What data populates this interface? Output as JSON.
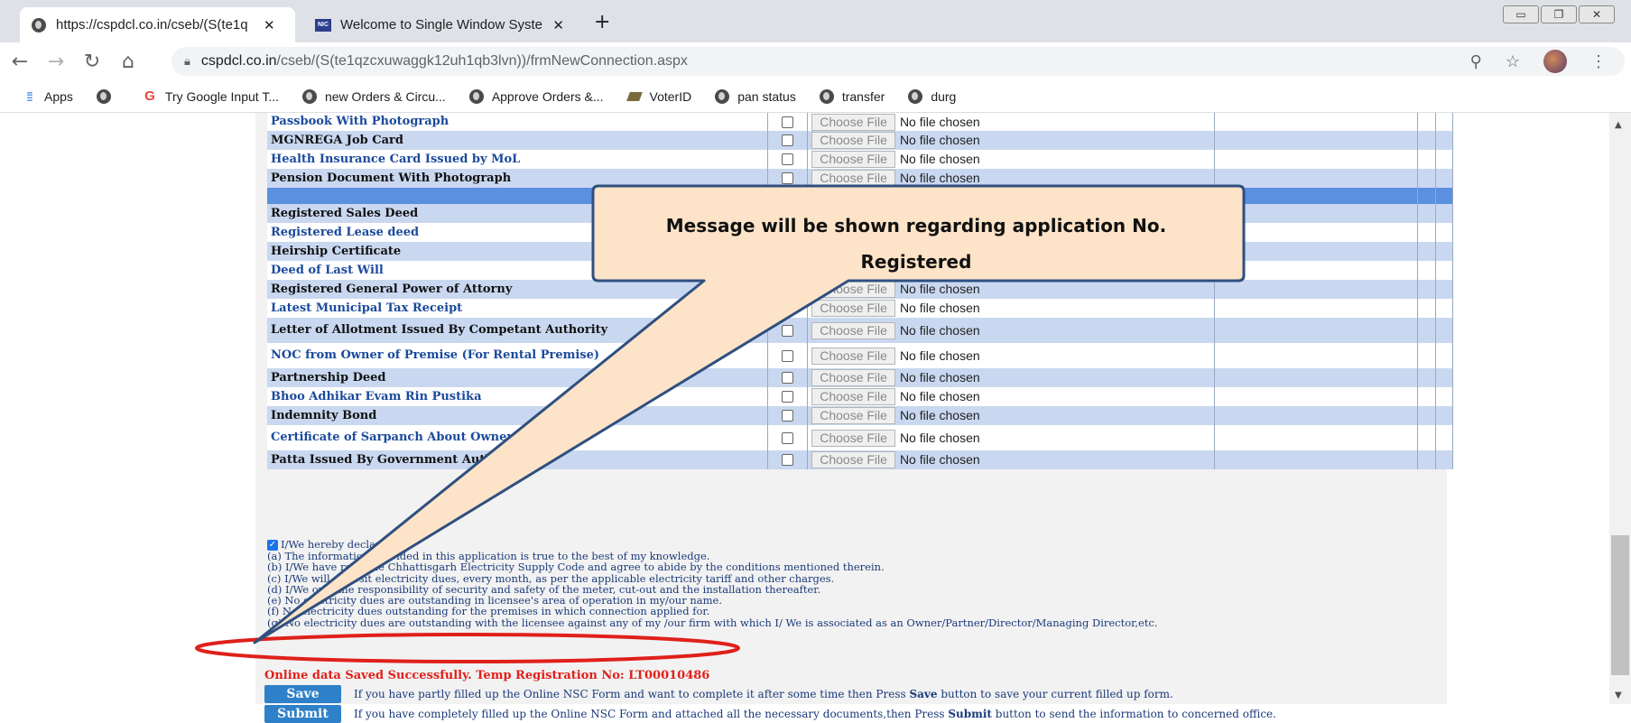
{
  "browser": {
    "tabs": [
      {
        "title": "https://cspdcl.co.in/cseb/(S(te1q",
        "close": "✕"
      },
      {
        "title": "Welcome to Single Window Syste",
        "close": "✕"
      }
    ],
    "new_tab": "+",
    "url_host": "cspdcl.co.in",
    "url_path": "/cseb/(S(te1qzcxuwaggk12uh1qb3lvn))/frmNewConnection.aspx"
  },
  "bookmarks": [
    {
      "label": "Apps",
      "icon": "apps-grid-icon"
    },
    {
      "label": "",
      "icon": "globe-icon"
    },
    {
      "label": "Try Google Input T...",
      "icon": "google-icon"
    },
    {
      "label": "new Orders & Circu...",
      "icon": "globe-icon"
    },
    {
      "label": "Approve Orders &...",
      "icon": "globe-icon"
    },
    {
      "label": "VoterID",
      "icon": "voterid-icon"
    },
    {
      "label": "pan status",
      "icon": "globe-icon"
    },
    {
      "label": "transfer",
      "icon": "globe-icon"
    },
    {
      "label": "durg",
      "icon": "globe-icon"
    }
  ],
  "file_widget": {
    "button": "Choose File",
    "status": "No file chosen"
  },
  "documents": [
    {
      "name": "Passbook With Photograph",
      "row": "white",
      "color": "navy",
      "file": true
    },
    {
      "name": "MGNREGA Job Card",
      "row": "blue",
      "color": "black",
      "file": true
    },
    {
      "name": "Health Insurance Card Issued by MoL",
      "row": "white",
      "color": "navy",
      "file": true
    },
    {
      "name": "Pension Document With Photograph",
      "row": "blue",
      "color": "black",
      "file": true
    },
    {
      "name": "",
      "row": "sep",
      "color": "black",
      "file": false
    },
    {
      "name": "Registered Sales Deed",
      "row": "blue",
      "color": "black",
      "file": false
    },
    {
      "name": "Registered Lease deed",
      "row": "white",
      "color": "navy",
      "file": false
    },
    {
      "name": "Heirship Certificate",
      "row": "blue",
      "color": "black",
      "file": false
    },
    {
      "name": "Deed of Last Will",
      "row": "white",
      "color": "navy",
      "file": true
    },
    {
      "name": "Registered General Power of Attorny",
      "row": "blue",
      "color": "black",
      "file": true
    },
    {
      "name": "Latest Municipal Tax Receipt",
      "row": "white",
      "color": "navy",
      "file": true
    },
    {
      "name": "Letter of Allotment Issued By Competant Authority",
      "row": "blue",
      "color": "black",
      "file": true
    },
    {
      "name": "NOC from Owner of Premise (For Rental Premise)",
      "row": "white",
      "color": "navy",
      "file": true
    },
    {
      "name": "Partnership Deed",
      "row": "blue",
      "color": "black",
      "file": true
    },
    {
      "name": "Bhoo Adhikar Evam Rin Pustika",
      "row": "white",
      "color": "navy",
      "file": true
    },
    {
      "name": "Indemnity Bond",
      "row": "blue",
      "color": "black",
      "file": true
    },
    {
      "name": "Certificate of Sarpanch About Ownership",
      "row": "white",
      "color": "navy",
      "file": true
    },
    {
      "name": "Patta Issued By Government Authorities",
      "row": "blue",
      "color": "black",
      "file": true
    }
  ],
  "declaration": {
    "intro": "I/We hereby declare that",
    "lines": [
      "(a) The information provided in this application is true to the best of my knowledge.",
      "(b) I/We have read the Chhattisgarh Electricity Supply Code and agree to abide by the conditions mentioned therein.",
      "(c) I/We will deposit electricity dues, every month, as per the applicable electricity tariff and other charges.",
      "(d) I/We own the responsibility of security and safety of the meter, cut-out and the installation thereafter.",
      "(e) No electricity dues are outstanding in licensee's area of operation in my/our name.",
      "(f) No electricity dues outstanding for the premises in which connection applied for.",
      "(g) No electricity dues are outstanding with the licensee against any of my /our firm with which I/ We is associated as an Owner/Partner/Director/Managing Director,etc."
    ]
  },
  "success_message": "Online data Saved Successfully. Temp Registration No: LT00010486",
  "actions": {
    "save_label": "Save",
    "save_pre": "If you have partly filled up the Online NSC Form and want to complete it after some time then Press ",
    "save_bold": "Save",
    "save_post": " button to save your current filled up form.",
    "submit_label": "Submit",
    "submit_pre": "If you have completely filled up the Online NSC Form and attached all the necessary documents,then Press ",
    "submit_bold": "Submit",
    "submit_post": " button to send the information to concerned office."
  },
  "callout": {
    "line1": "Message will be shown regarding application No.",
    "line2": "Registered",
    "fill": "#fde3c8",
    "stroke": "#2f4f7f",
    "highlight": "#e0201a"
  }
}
